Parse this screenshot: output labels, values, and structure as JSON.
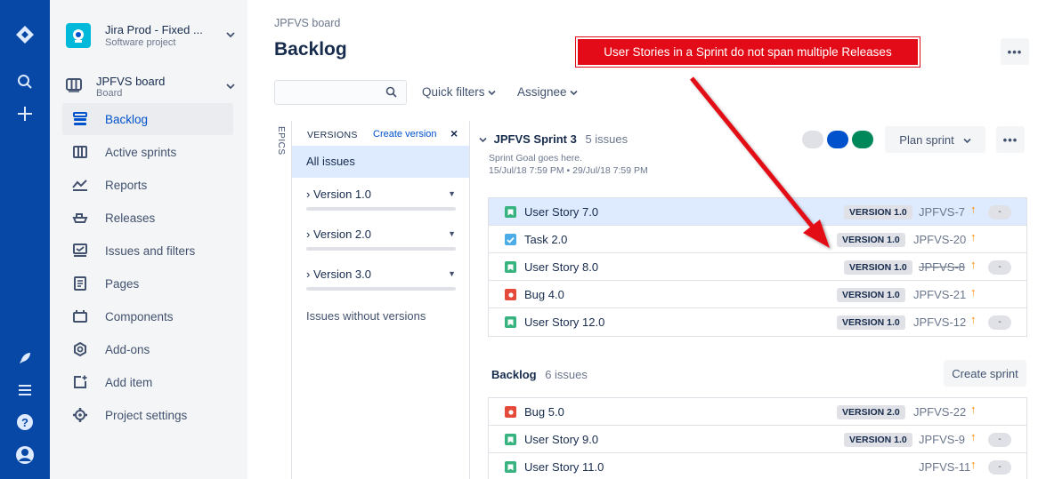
{
  "project": {
    "name": "Jira Prod - Fixed ...",
    "type": "Software project"
  },
  "board": {
    "name": "JPFVS board",
    "type": "Board"
  },
  "sidebar": {
    "items": [
      {
        "label": "Backlog",
        "icon": "backlog-icon",
        "active": true
      },
      {
        "label": "Active sprints",
        "icon": "active-sprints-icon"
      },
      {
        "label": "Reports",
        "icon": "reports-icon"
      },
      {
        "label": "Releases",
        "icon": "releases-icon"
      },
      {
        "label": "Issues and filters",
        "icon": "issues-icon"
      },
      {
        "label": "Pages",
        "icon": "pages-icon"
      },
      {
        "label": "Components",
        "icon": "components-icon"
      },
      {
        "label": "Add-ons",
        "icon": "add-ons-icon"
      },
      {
        "label": "Add item",
        "icon": "add-item-icon"
      },
      {
        "label": "Project settings",
        "icon": "settings-icon"
      }
    ]
  },
  "header": {
    "breadcrumb": "JPFVS board",
    "title": "Backlog",
    "more": "•••"
  },
  "filters": {
    "quick": "Quick filters",
    "assignee": "Assignee"
  },
  "epics_label": "EPICS",
  "versions": {
    "header": "VERSIONS",
    "create": "Create version",
    "close": "×",
    "all": "All issues",
    "items": [
      {
        "name": "Version 1.0"
      },
      {
        "name": "Version 2.0"
      },
      {
        "name": "Version 3.0"
      }
    ],
    "none": "Issues without versions"
  },
  "sprint": {
    "name": "JPFVS Sprint 3",
    "count": "5 issues",
    "goal": "Sprint Goal goes here.",
    "dates": "15/Jul/18 7:59 PM • 29/Jul/18 7:59 PM",
    "plan": "Plan sprint",
    "more": "•••",
    "status_colors": [
      "#dfe1e6",
      "#0052cc",
      "#00875a"
    ],
    "issues": [
      {
        "type": "story",
        "title": "User Story 7.0",
        "version": "VERSION 1.0",
        "key": "JPFVS-7",
        "est": "-",
        "selected": true
      },
      {
        "type": "task",
        "title": "Task 2.0",
        "version": "VERSION 1.0",
        "key": "JPFVS-20",
        "est": ""
      },
      {
        "type": "story",
        "title": "User Story 8.0",
        "version": "VERSION 1.0",
        "key": "JPFVS-8",
        "est": "-",
        "done": true
      },
      {
        "type": "bug",
        "title": "Bug 4.0",
        "version": "VERSION 1.0",
        "key": "JPFVS-21",
        "est": ""
      },
      {
        "type": "story",
        "title": "User Story 12.0",
        "version": "VERSION 1.0",
        "key": "JPFVS-12",
        "est": "-"
      }
    ]
  },
  "backlog": {
    "title": "Backlog",
    "count": "6 issues",
    "create": "Create sprint",
    "issues": [
      {
        "type": "bug",
        "title": "Bug 5.0",
        "version": "VERSION 2.0",
        "key": "JPFVS-22",
        "est": ""
      },
      {
        "type": "story",
        "title": "User Story 9.0",
        "version": "VERSION 1.0",
        "key": "JPFVS-9",
        "est": "-"
      },
      {
        "type": "story",
        "title": "User Story 11.0",
        "version": "",
        "key": "JPFVS-11",
        "est": "-"
      }
    ]
  },
  "annotation": {
    "text": "User Stories in a Sprint do not span multiple Releases"
  },
  "colors": {
    "nav": "#0747a6",
    "story": "#36b37e",
    "task": "#4bade8",
    "bug": "#e5493a",
    "callout": "#e30b17"
  }
}
